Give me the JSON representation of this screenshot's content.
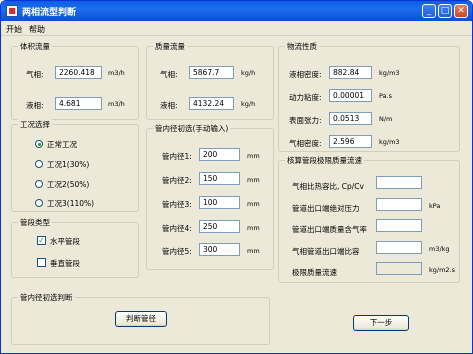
{
  "window": {
    "title": "两相流型判断",
    "minimize": "_",
    "maximize": "□",
    "close": "✕"
  },
  "menu": [
    {
      "label": "开始"
    },
    {
      "label": "帮助"
    }
  ],
  "volume_flow": {
    "legend": "体积流量",
    "gas": {
      "label": "气相:",
      "value": "2260.418",
      "unit": "m3/h"
    },
    "liquid": {
      "label": "液相:",
      "value": "4.681",
      "unit": "m3/h"
    }
  },
  "mass_flow": {
    "legend": "质量流量",
    "gas": {
      "label": "气相:",
      "value": "5867.7",
      "unit": "kg/h"
    },
    "liquid": {
      "label": "液相:",
      "value": "4132.24",
      "unit": "kg/h"
    }
  },
  "properties": {
    "legend": "物流性质",
    "rows": [
      {
        "label": "液相密度:",
        "value": "882.84",
        "unit": "kg/m3"
      },
      {
        "label": "动力粘度:",
        "value": "0.00001",
        "unit": "Pa.s"
      },
      {
        "label": "表面张力:",
        "value": "0.0513",
        "unit": "N/m"
      },
      {
        "label": "气相密度:",
        "value": "2.596",
        "unit": "kg/m3"
      }
    ]
  },
  "conditions": {
    "legend": "工况选择",
    "options": [
      {
        "label": "正常工况",
        "selected": true
      },
      {
        "label": "工况1(30%)",
        "selected": false
      },
      {
        "label": "工况2(50%)",
        "selected": false
      },
      {
        "label": "工况3(110%)",
        "selected": false
      }
    ]
  },
  "pipe_diameter": {
    "legend": "管内径初选(手动输入)",
    "rows": [
      {
        "label": "管内径1:",
        "value": "200",
        "unit": "mm"
      },
      {
        "label": "管内径2:",
        "value": "150",
        "unit": "mm"
      },
      {
        "label": "管内径3:",
        "value": "100",
        "unit": "mm"
      },
      {
        "label": "管内径4:",
        "value": "250",
        "unit": "mm"
      },
      {
        "label": "管内径5:",
        "value": "300",
        "unit": "mm"
      }
    ]
  },
  "pipe_type": {
    "legend": "管段类型",
    "options": [
      {
        "label": "水平管段",
        "checked": true
      },
      {
        "label": "垂直管段",
        "checked": false
      }
    ]
  },
  "critical_flow": {
    "legend": "核算管段极限质量流速",
    "rows": [
      {
        "label": "气相比热容比, Cp/Cv",
        "value": "",
        "unit": ""
      },
      {
        "label": "管道出口端绝对压力",
        "value": "",
        "unit": "kPa"
      },
      {
        "label": "管道出口端质量含气率",
        "value": "",
        "unit": ""
      },
      {
        "label": "气相管道出口端比容",
        "value": "",
        "unit": "m3/kg"
      },
      {
        "label": "极限质量流速",
        "value": "",
        "unit": "kg/m2.s"
      }
    ]
  },
  "judge": {
    "legend": "管内径初选判断",
    "button": "判断管径"
  },
  "next_button": "下一步",
  "colors": {
    "title_bar": "#0a5fe0",
    "window_bg": "#ece9d8",
    "check_mark": "#21a121"
  }
}
